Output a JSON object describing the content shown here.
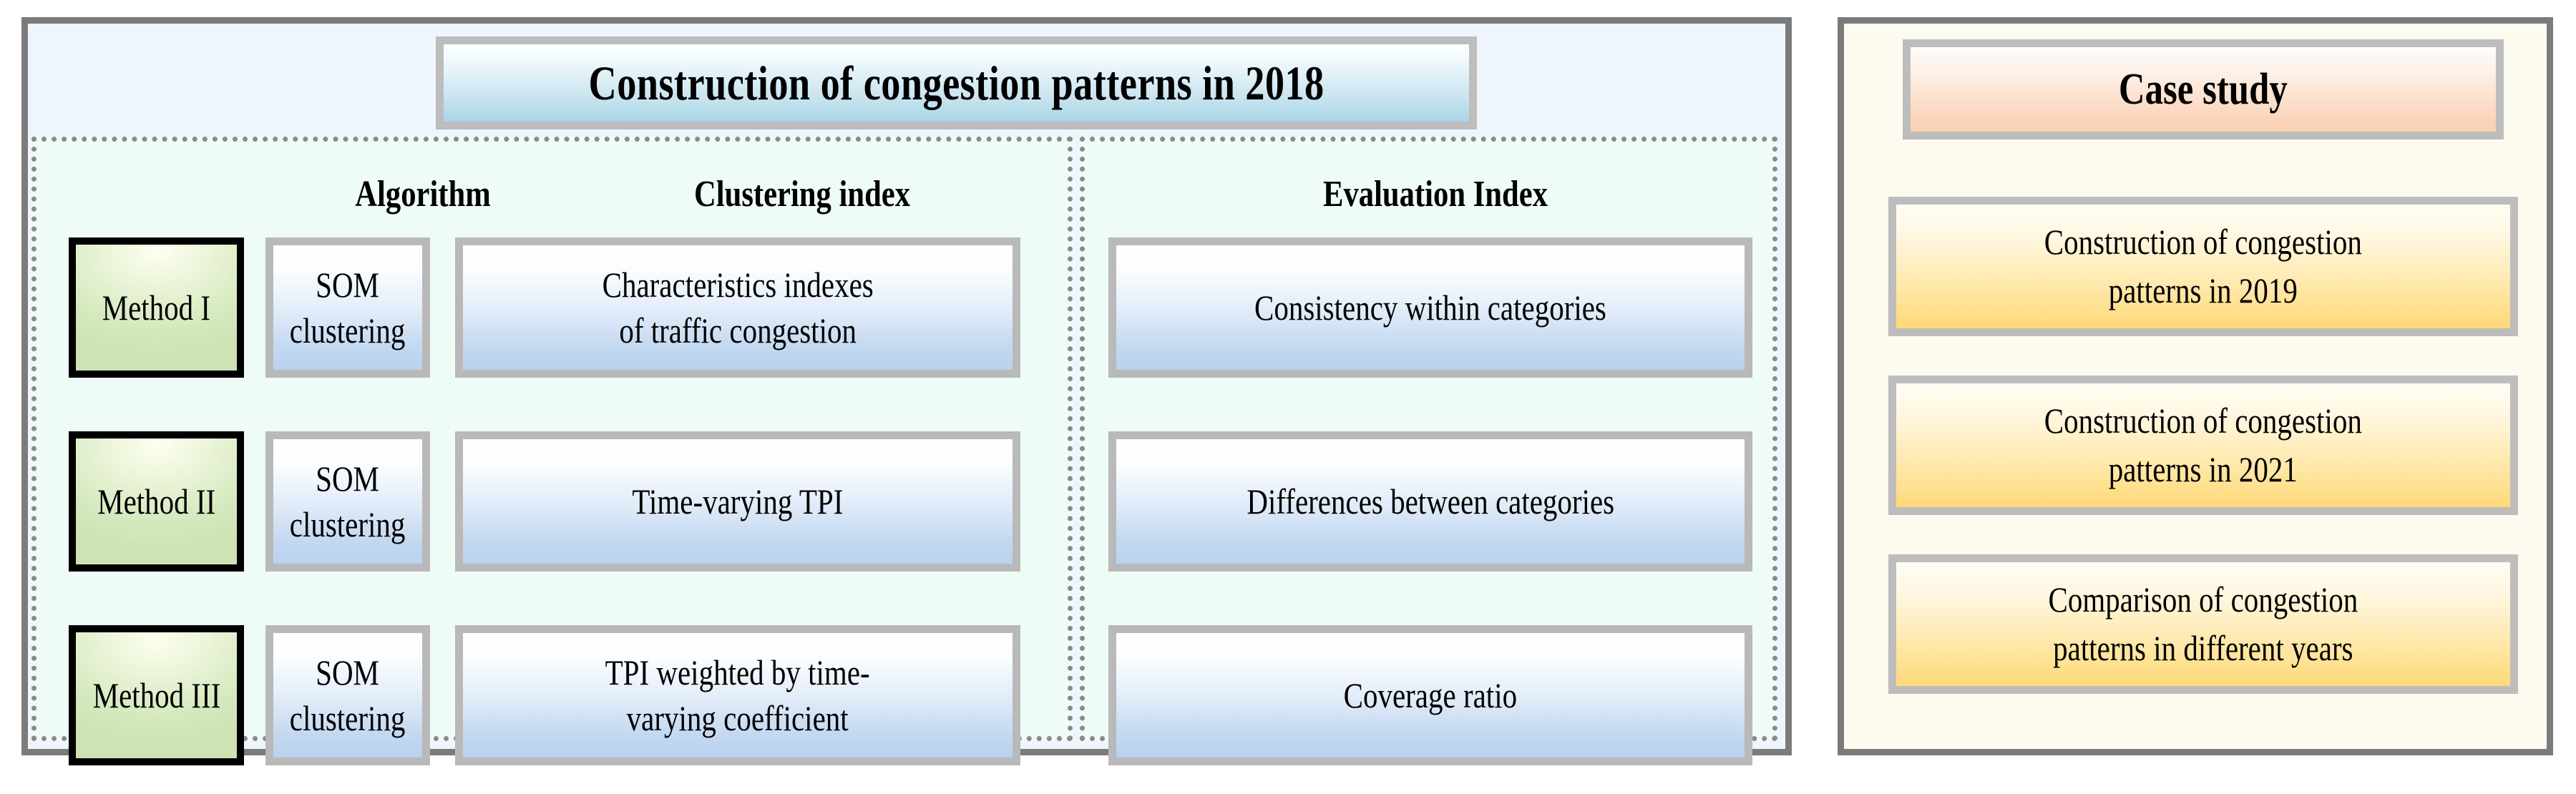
{
  "left_panel": {
    "title": "Construction of congestion patterns in 2018",
    "columns": {
      "method": "",
      "algorithm": "Algorithm",
      "clustering_index": "Clustering index",
      "evaluation_index": "Evaluation Index"
    },
    "rows": [
      {
        "method": "Method I",
        "algorithm": "SOM\nclustering",
        "clustering_index": "Characteristics indexes\nof traffic congestion",
        "evaluation_index": "Consistency within categories"
      },
      {
        "method": "Method II",
        "algorithm": "SOM\nclustering",
        "clustering_index": "Time-varying TPI",
        "evaluation_index": "Differences between categories"
      },
      {
        "method": "Method III",
        "algorithm": "SOM\nclustering",
        "clustering_index": "TPI weighted by time-\nvarying coefficient",
        "evaluation_index": "Coverage ratio"
      }
    ]
  },
  "right_panel": {
    "title": "Case study",
    "items": [
      {
        "label": "Construction of congestion\npatterns in 2019"
      },
      {
        "label": "Construction of congestion\npatterns in 2021"
      },
      {
        "label": "Comparison of congestion\npatterns in different years"
      }
    ]
  },
  "colors": {
    "panel_border": "#7b7b7b",
    "left_panel_bg": "#eef5fc",
    "dashed_bg": "#eefbf6",
    "dashed_border": "#8a8a8a",
    "box_border": "#bdbdbd",
    "method_border": "#000000",
    "blue_box_top": "#ffffff",
    "blue_box_bottom": "#b9d2ee",
    "method_box_fill": "#cde3b4",
    "right_panel_bg": "#fdfaef",
    "case_title_bottom": "#f9cfb2",
    "case_item_bottom": "#ffd977"
  }
}
